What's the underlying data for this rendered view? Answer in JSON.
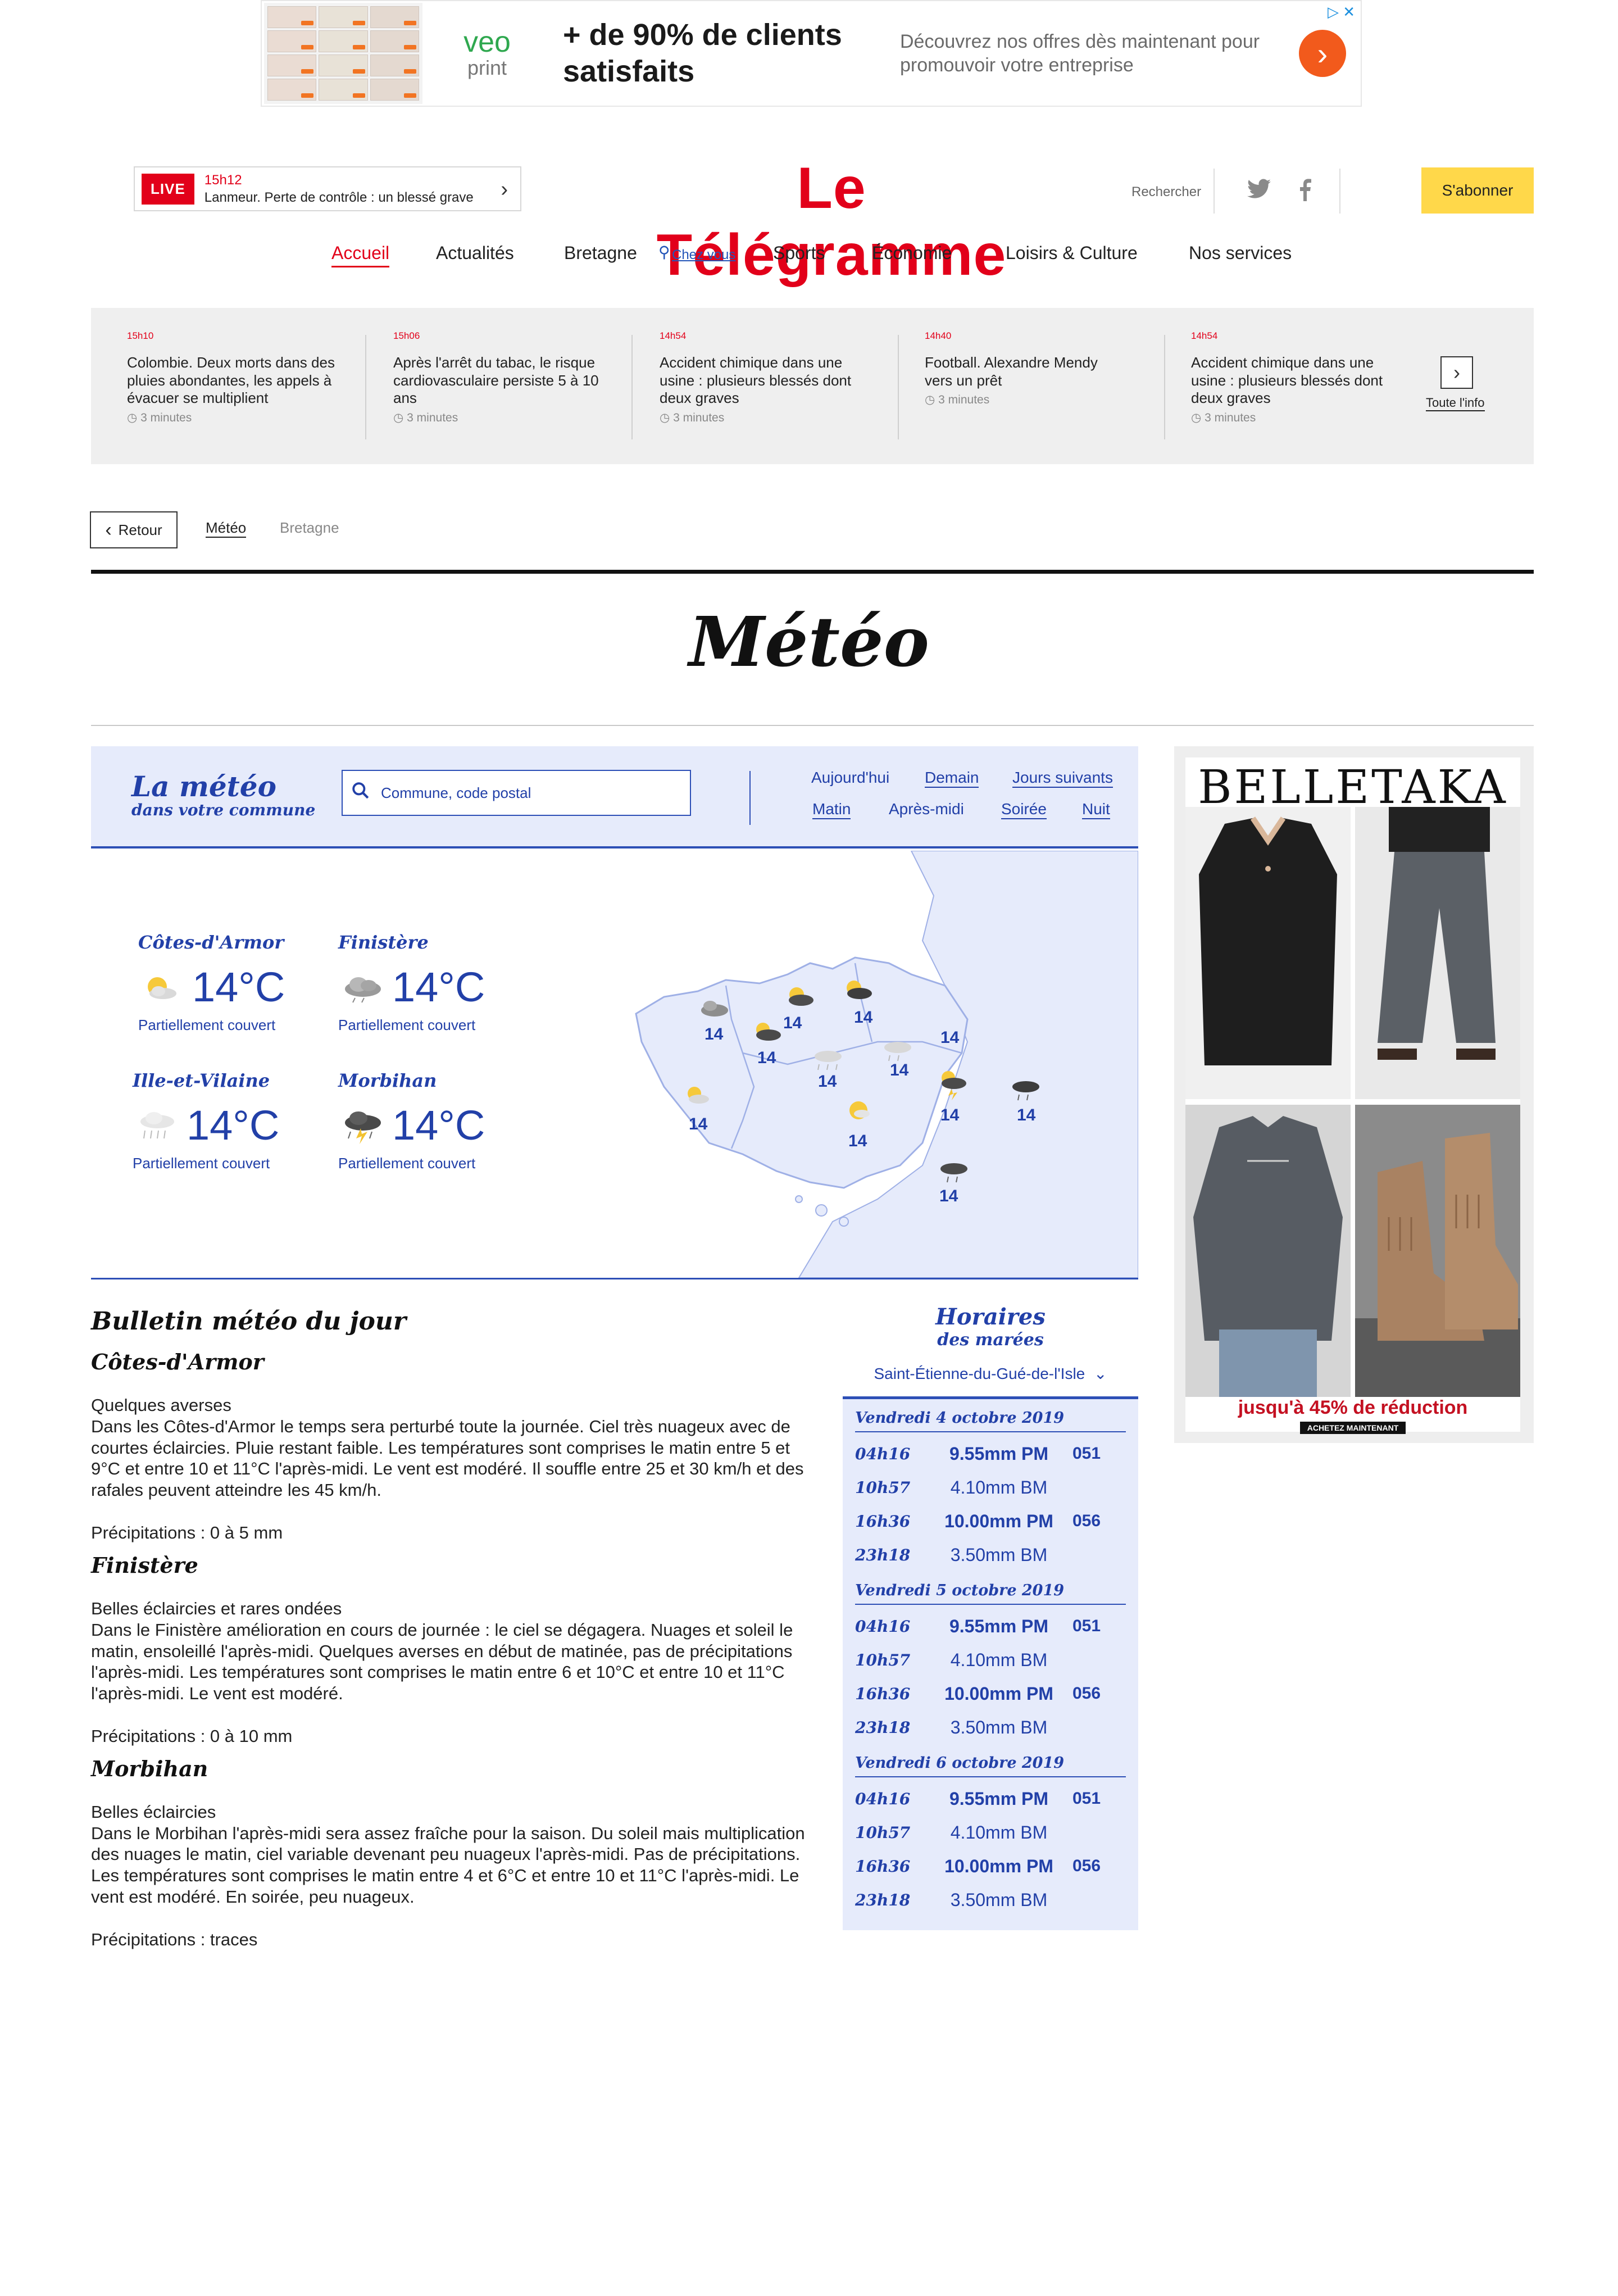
{
  "ad_banner": {
    "headline": "+ de 90% de clients satisfaits",
    "description": "Découvrez nos offres dès maintenant pour promouvoir votre entreprise",
    "brand_top": "veo",
    "brand_bottom": "print",
    "arrow": "›",
    "choices": "▷ ✕"
  },
  "live": {
    "badge": "LIVE",
    "time": "15h12",
    "headline": "Lanmeur. Perte de contrôle : un blessé grave"
  },
  "logo": "Le Télégramme",
  "header": {
    "search_label": "Rechercher",
    "twitter_icon": "twitter-icon",
    "facebook_icon": "facebook-icon",
    "subscribe_label": "S'abonner"
  },
  "nav": {
    "items": [
      "Accueil",
      "Actualités",
      "Bretagne",
      "Chez vous",
      "Sports",
      "Économie",
      "Loisirs & Culture",
      "Nos services"
    ]
  },
  "news": {
    "items": [
      {
        "time": "15h10",
        "title": "Colombie. Deux morts dans des pluies abondantes, les appels à évacuer se multiplient",
        "read": "◷ 3 minutes"
      },
      {
        "time": "15h06",
        "title": "Après l'arrêt du tabac, le risque cardiovasculaire persiste 5 à 10 ans",
        "read": "◷ 3 minutes"
      },
      {
        "time": "14h54",
        "title": "Accident chimique dans une usine : plusieurs blessés dont deux graves",
        "read": "◷ 3 minutes"
      },
      {
        "time": "14h40",
        "title": "Football. Alexandre Mendy vers un prêt",
        "read": "◷ 3 minutes"
      },
      {
        "time": "14h54",
        "title": "Accident chimique dans une usine : plusieurs blessés dont deux graves",
        "read": "◷ 3 minutes"
      }
    ],
    "all_label": "Toute l'info"
  },
  "breadcrumb": {
    "back_label": "Retour",
    "items": [
      "Météo",
      "Bretagne"
    ]
  },
  "page_title": "Météo",
  "weather_bar": {
    "title_big": "La météo",
    "title_small": "dans votre commune",
    "search_placeholder": "Commune, code postal",
    "days": [
      "Aujourd'hui",
      "Demain",
      "Jours suivants"
    ],
    "periods": [
      "Matin",
      "Après-midi",
      "Soirée",
      "Nuit"
    ]
  },
  "departments": [
    {
      "name": "Côtes-d'Armor",
      "temp": "14°C",
      "desc": "Partiellement couvert",
      "icon": "sun-cloud-icon"
    },
    {
      "name": "Finistère",
      "temp": "14°C",
      "desc": "Partiellement couvert",
      "icon": "cloud-icon"
    },
    {
      "name": "Ille-et-Vilaine",
      "temp": "14°C",
      "desc": "Partiellement couvert",
      "icon": "rain-cloud-icon"
    },
    {
      "name": "Morbihan",
      "temp": "14°C",
      "desc": "Partiellement couvert",
      "icon": "storm-cloud-icon"
    }
  ],
  "map_temps": [
    "14",
    "14",
    "14",
    "14",
    "14",
    "14",
    "14",
    "14",
    "14",
    "14",
    "14",
    "14"
  ],
  "bulletin": {
    "title": "Bulletin météo du jour",
    "sections": [
      {
        "name": "Côtes-d'Armor",
        "summary": "Quelques averses",
        "text": "Dans les Côtes-d'Armor le temps sera perturbé toute la journée. Ciel très nuageux avec de courtes éclaircies. Pluie restant faible. Les températures sont comprises le matin entre 5 et 9°C et entre 10 et 11°C l'après-midi. Le vent est modéré. Il souffle entre 25 et 30 km/h et des rafales peuvent atteindre les 45 km/h.",
        "precip": "Précipitations : 0 à 5 mm"
      },
      {
        "name": "Finistère",
        "summary": "Belles éclaircies et rares ondées",
        "text": "Dans le Finistère amélioration en cours de journée : le ciel se dégagera. Nuages et soleil le matin, ensoleillé l'après-midi. Quelques averses en début de matinée, pas de précipitations l'après-midi. Les températures sont comprises le matin entre 6 et 10°C et entre 10 et 11°C l'après-midi. Le vent est modéré.",
        "precip": "Précipitations : 0 à 10 mm"
      },
      {
        "name": "Morbihan",
        "summary": "Belles éclaircies",
        "text": "Dans le Morbihan l'après-midi sera assez fraîche pour la saison. Du soleil mais multiplication des nuages le matin, ciel variable devenant peu nuageux l'après-midi. Pas de précipitations. Les températures sont comprises le matin entre 4 et 6°C et entre 10 et 11°C l'après-midi. Le vent est modéré. En soirée, peu nuageux.",
        "precip": "Précipitations : traces"
      }
    ]
  },
  "tides": {
    "title_big": "Horaires",
    "title_small": "des marées",
    "place": "Saint-Étienne-du-Gué-de-l'Isle",
    "days": [
      {
        "date": "Vendredi 4 octobre 2019",
        "rows": [
          {
            "time": "04h16",
            "height": "9.55mm PM",
            "coef": "051"
          },
          {
            "time": "10h57",
            "height": "4.10mm BM",
            "coef": ""
          },
          {
            "time": "16h36",
            "height": "10.00mm PM",
            "coef": "056"
          },
          {
            "time": "23h18",
            "height": "3.50mm BM",
            "coef": ""
          }
        ]
      },
      {
        "date": "Vendredi 5 octobre 2019",
        "rows": [
          {
            "time": "04h16",
            "height": "9.55mm PM",
            "coef": "051"
          },
          {
            "time": "10h57",
            "height": "4.10mm BM",
            "coef": ""
          },
          {
            "time": "16h36",
            "height": "10.00mm PM",
            "coef": "056"
          },
          {
            "time": "23h18",
            "height": "3.50mm BM",
            "coef": ""
          }
        ]
      },
      {
        "date": "Vendredi 6 octobre 2019",
        "rows": [
          {
            "time": "04h16",
            "height": "9.55mm PM",
            "coef": "051"
          },
          {
            "time": "10h57",
            "height": "4.10mm BM",
            "coef": ""
          },
          {
            "time": "16h36",
            "height": "10.00mm PM",
            "coef": "056"
          },
          {
            "time": "23h18",
            "height": "3.50mm BM",
            "coef": ""
          }
        ]
      }
    ]
  },
  "side_ad": {
    "brand": "BELLETAKA",
    "promo": "jusqu'à 45% de réduction",
    "cta": "ACHETEZ MAINTENANT"
  },
  "colors": {
    "brand_red": "#e2001a",
    "weather_blue": "#2240a8",
    "weather_bg": "#e6ebfb",
    "subscribe_yellow": "#ffd84a"
  }
}
